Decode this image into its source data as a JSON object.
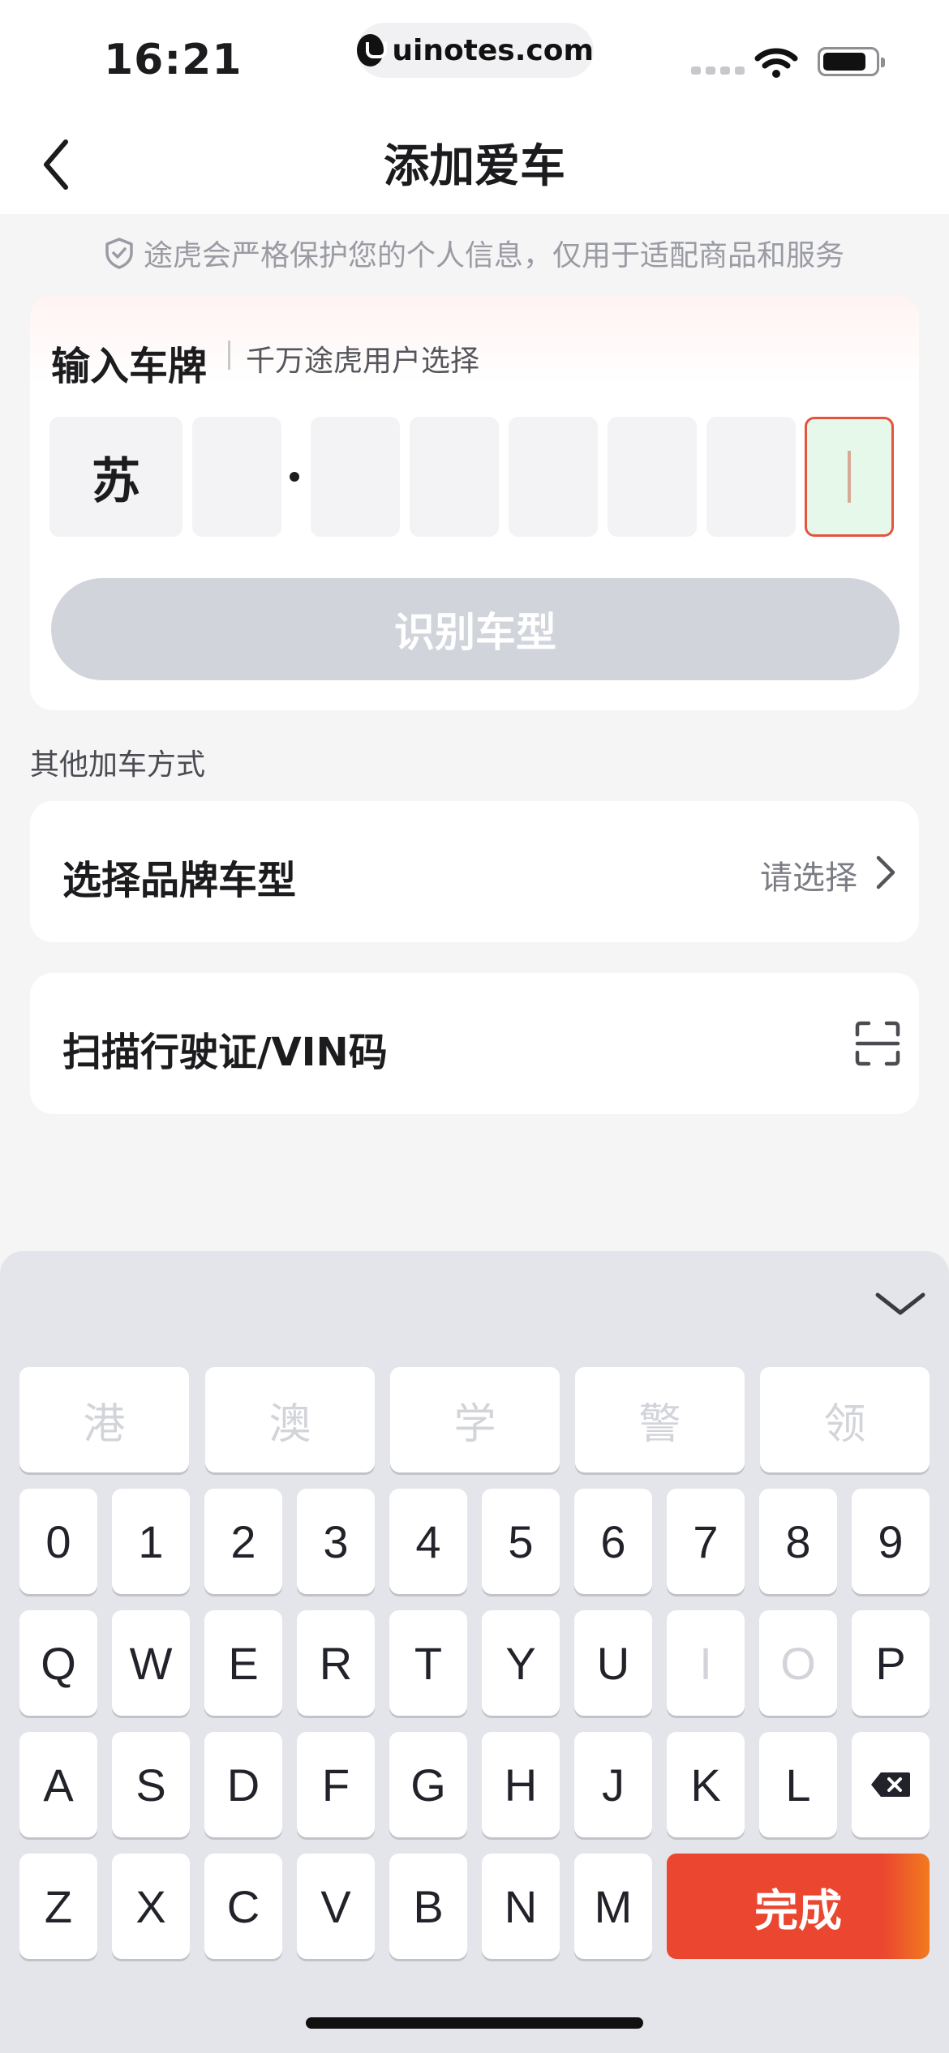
{
  "status_bar": {
    "time": "16:21",
    "url": "uinotes.com"
  },
  "nav": {
    "title": "添加爱车"
  },
  "privacy_note": "途虎会严格保护您的个人信息，仅用于适配商品和服务",
  "plate_card": {
    "title": "输入车牌",
    "subtitle": "千万途虎用户选择",
    "plate_chars": [
      "苏",
      "",
      "",
      "",
      "",
      "",
      "",
      ""
    ],
    "identify_button": "识别车型"
  },
  "other_section": {
    "label": "其他加车方式"
  },
  "brand_option": {
    "label": "选择品牌车型",
    "value": "请选择"
  },
  "scan_option": {
    "label": "扫描行驶证/VIN码"
  },
  "keyboard": {
    "special_row": [
      "港",
      "澳",
      "学",
      "警",
      "领"
    ],
    "digit_row": [
      "0",
      "1",
      "2",
      "3",
      "4",
      "5",
      "6",
      "7",
      "8",
      "9"
    ],
    "letter_row_1": [
      "Q",
      "W",
      "E",
      "R",
      "T",
      "Y",
      "U",
      "I",
      "O",
      "P"
    ],
    "letter_row_2": [
      "A",
      "S",
      "D",
      "F",
      "G",
      "H",
      "J",
      "K",
      "L"
    ],
    "letter_row_3": [
      "Z",
      "X",
      "C",
      "V",
      "B",
      "N",
      "M"
    ],
    "done_button": "完成"
  }
}
